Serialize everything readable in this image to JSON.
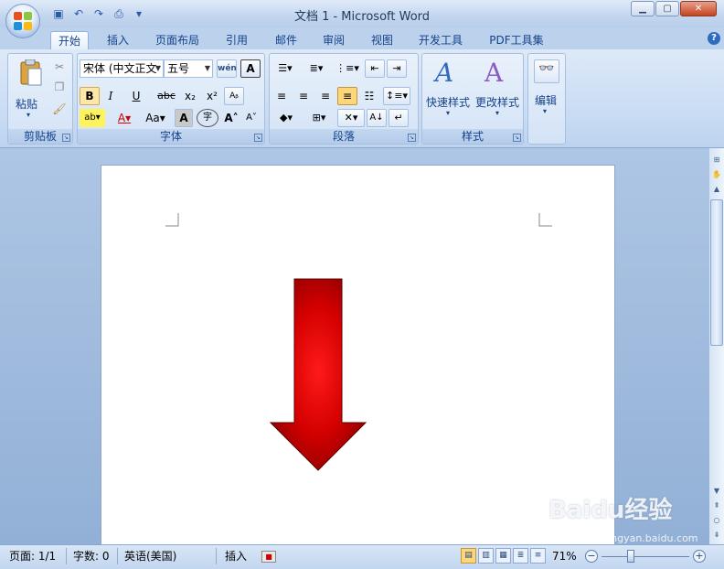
{
  "window": {
    "title": "文档 1 - Microsoft Word"
  },
  "qat": {
    "items": [
      "save-icon",
      "undo-icon",
      "redo-icon",
      "print-preview-icon",
      "customize-icon"
    ]
  },
  "tabs": [
    {
      "label": "开始",
      "active": true
    },
    {
      "label": "插入"
    },
    {
      "label": "页面布局"
    },
    {
      "label": "引用"
    },
    {
      "label": "邮件"
    },
    {
      "label": "审阅"
    },
    {
      "label": "视图"
    },
    {
      "label": "开发工具"
    },
    {
      "label": "PDF工具集"
    }
  ],
  "ribbon": {
    "clipboard": {
      "label": "剪贴板",
      "paste": "粘贴"
    },
    "font": {
      "label": "字体",
      "font_name": "宋体 (中文正文",
      "font_size": "五号",
      "bold": "B",
      "italic": "I",
      "underline": "U",
      "strike": "abc",
      "sub": "x₂",
      "sup": "x²",
      "grow": "A",
      "shrink": "A",
      "case": "Aa",
      "phonetic": "wén",
      "border_a": "A",
      "charshade_a": "A",
      "enclose": "字"
    },
    "paragraph": {
      "label": "段落"
    },
    "styles": {
      "label": "样式",
      "quick": "快速样式",
      "change": "更改样式"
    },
    "editing": {
      "label": "编辑"
    }
  },
  "status": {
    "page": "页面: 1/1",
    "words": "字数: 0",
    "lang": "英语(美国)",
    "mode": "插入",
    "zoom": "71%"
  },
  "watermark": {
    "brand": "Baidu经验",
    "url": "jingyan.baidu.com"
  },
  "colors": {
    "arrow": "#e00000",
    "ribbon": "#c7dbf3",
    "workspace": "#a3bde0"
  }
}
